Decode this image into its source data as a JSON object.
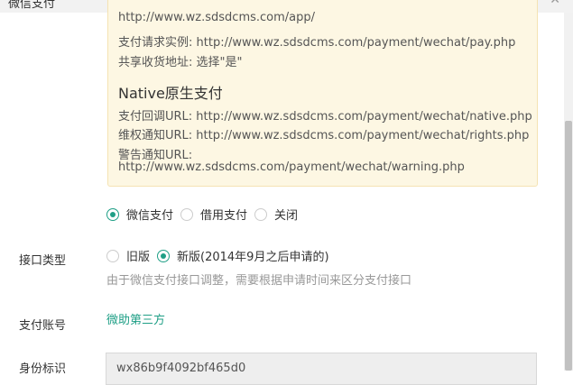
{
  "dialog": {
    "title": "微信支付",
    "close_icon": "close-icon"
  },
  "notice": {
    "lines_top": [
      "http://www.wz.sdsdcms.com/app/",
      "支付请求实例: http://www.wz.sdsdcms.com/payment/wechat/pay.php",
      "共享收货地址: 选择\"是\""
    ],
    "native_title": "Native原生支付",
    "lines_native": [
      "支付回调URL: http://www.wz.sdsdcms.com/payment/wechat/native.php",
      "维权通知URL: http://www.wz.sdsdcms.com/payment/wechat/rights.php",
      "警告通知URL:",
      "http://www.wz.sdsdcms.com/payment/wechat/warning.php"
    ]
  },
  "payment_mode": {
    "options": [
      "微信支付",
      "借用支付",
      "关闭"
    ],
    "selected": "微信支付"
  },
  "interface_type": {
    "label": "接口类型",
    "options": [
      "旧版",
      "新版(2014年9月之后申请的)"
    ],
    "selected": "新版(2014年9月之后申请的)",
    "help": "由于微信支付接口调整，需要根据申请时间来区分支付接口"
  },
  "pay_account": {
    "label": "支付账号",
    "link": "微助第三方"
  },
  "identity": {
    "label": "身份标识",
    "value": "wx86b9f4092bf465d0"
  },
  "colors": {
    "accent": "#1f9f86",
    "notice_bg": "#fdf7e3"
  }
}
